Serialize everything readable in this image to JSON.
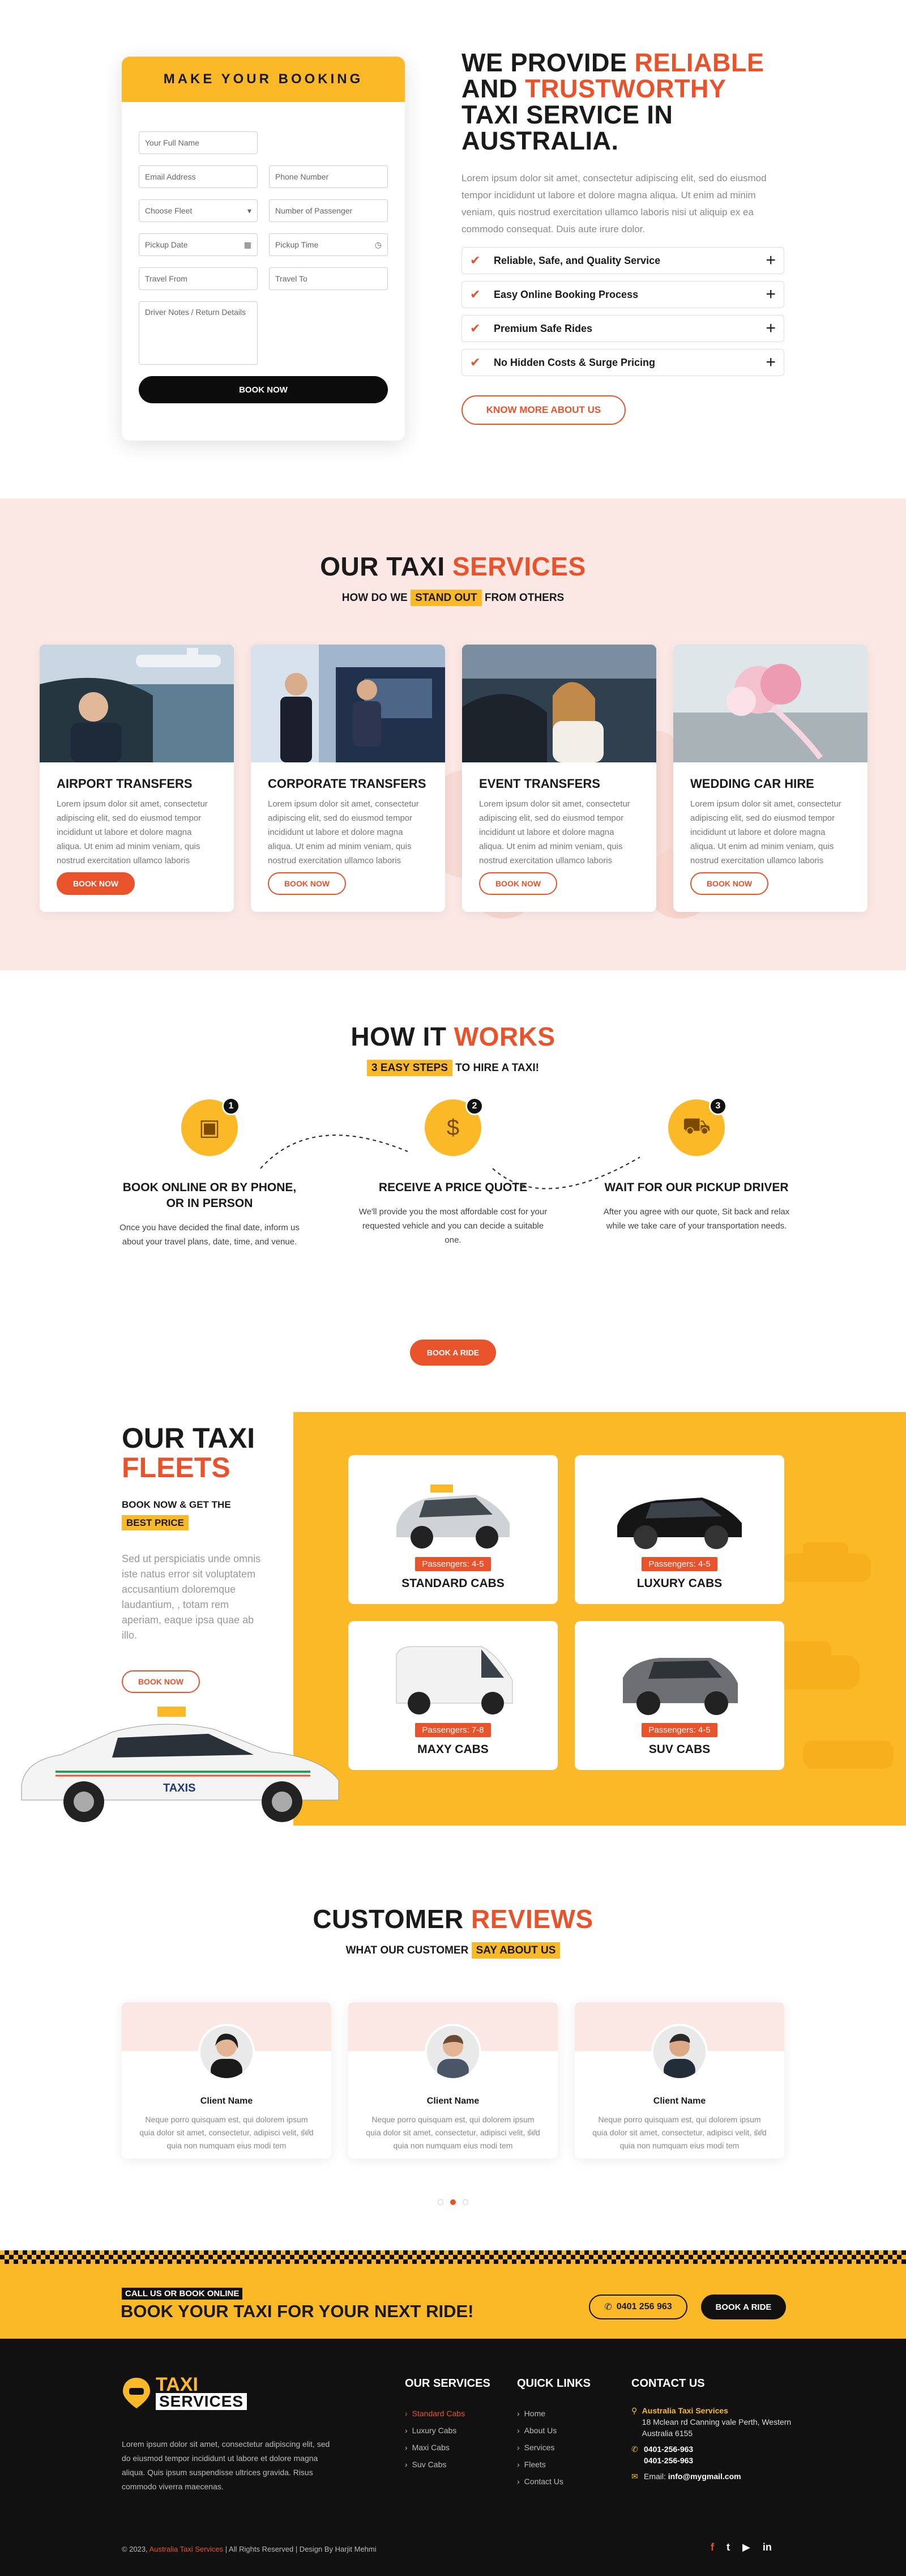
{
  "booking": {
    "title": "MAKE YOUR BOOKING",
    "full_name": "Your Full Name",
    "email": "Email Address",
    "phone": "Phone Number",
    "fleet": "Choose Fleet",
    "passengers": "Number of Passenger",
    "pickup_date": "Pickup Date",
    "pickup_time": "Pickup Time",
    "travel_from": "Travel From",
    "travel_to": "Travel To",
    "notes": "Driver Notes / Return Details",
    "button": "BOOK NOW"
  },
  "hero": {
    "title_a": "WE PROVIDE ",
    "title_b": "RELIABLE",
    "title_c": "AND ",
    "title_d": "TRUSTWORTHY",
    "title_e": "TAXI SERVICE IN",
    "title_f": "AUSTRALIA.",
    "text": "Lorem ipsum dolor sit amet, consectetur adipiscing elit, sed do eiusmod tempor incididunt ut labore et dolore magna aliqua. Ut enim ad minim veniam, quis nostrud exercitation ullamco laboris nisi ut aliquip ex ea commodo consequat. Duis aute irure dolor.",
    "features": [
      "Reliable, Safe, and Quality Service",
      "Easy Online Booking Process",
      "Premium Safe Rides",
      "No Hidden Costs & Surge Pricing"
    ],
    "button": "KNOW MORE ABOUT US"
  },
  "services": {
    "title_a": "OUR TAXI ",
    "title_b": "SERVICES",
    "sub_a": "HOW DO WE ",
    "sub_b": "STAND OUT",
    "sub_c": " FROM OTHERS",
    "cards": [
      {
        "name": "AIRPORT TRANSFERS",
        "desc": "Lorem ipsum dolor sit amet, consectetur adipiscing elit, sed do eiusmod tempor incididunt ut labore et dolore magna aliqua. Ut enim ad minim veniam, quis nostrud exercitation ullamco laboris",
        "button": "BOOK NOW"
      },
      {
        "name": "CORPORATE TRANSFERS",
        "desc": "Lorem ipsum dolor sit amet, consectetur adipiscing elit, sed do eiusmod tempor incididunt ut labore et dolore magna aliqua. Ut enim ad minim veniam, quis nostrud exercitation ullamco laboris",
        "button": "BOOK NOW"
      },
      {
        "name": "EVENT TRANSFERS",
        "desc": "Lorem ipsum dolor sit amet, consectetur adipiscing elit, sed do eiusmod tempor incididunt ut labore et dolore magna aliqua. Ut enim ad minim veniam, quis nostrud exercitation ullamco laboris",
        "button": "BOOK NOW"
      },
      {
        "name": "WEDDING CAR HIRE",
        "desc": "Lorem ipsum dolor sit amet, consectetur adipiscing elit, sed do eiusmod tempor incididunt ut labore et dolore magna aliqua. Ut enim ad minim veniam, quis nostrud exercitation ullamco laboris",
        "button": "BOOK NOW"
      }
    ]
  },
  "how": {
    "title_a": "HOW IT ",
    "title_b": "WORKS",
    "sub_a": "3 EASY STEPS",
    "sub_b": " TO HIRE A TAXI!",
    "steps": [
      {
        "num": "1",
        "icon": "calendar-check-icon",
        "title": "BOOK ONLINE OR BY PHONE, OR IN PERSON",
        "desc": "Once you have decided the final date, inform us about your travel plans, date, time, and venue."
      },
      {
        "num": "2",
        "icon": "dollar-bill-icon",
        "title": "RECEIVE A PRICE QUOTE",
        "desc": "We'll provide you the most affordable cost for your requested vehicle and you can decide a suitable one."
      },
      {
        "num": "3",
        "icon": "taxi-icon",
        "title": "WAIT FOR OUR PICKUP DRIVER",
        "desc": "After you agree with our quote, Sit back and relax while we take care of your transportation needs."
      }
    ],
    "button": "BOOK A RIDE"
  },
  "fleets": {
    "title_a": "OUR TAXI",
    "title_b": "FLEETS",
    "sub_a": "BOOK NOW & GET THE",
    "sub_b": "BEST PRICE",
    "text": "Sed ut perspiciatis unde omnis iste natus error sit voluptatem accusantium doloremque laudantium, , totam rem aperiam, eaque ipsa quae ab illo.",
    "button": "BOOK NOW",
    "cars": [
      {
        "pass": "Passengers: 4-5",
        "name": "STANDARD CABS"
      },
      {
        "pass": "Passengers: 4-5",
        "name": "LUXURY CABS"
      },
      {
        "pass": "Passengers: 7-8",
        "name": "MAXY CABS"
      },
      {
        "pass": "Passengers: 4-5",
        "name": "SUV CABS"
      }
    ],
    "car_door_text": "TAXIS"
  },
  "reviews": {
    "title_a": "CUSTOMER ",
    "title_b": "REVIEWS",
    "sub_a": "WHAT OUR CUSTOMER ",
    "sub_b": "SAY ABOUT US",
    "items": [
      {
        "name": "Client Name",
        "text": "Neque porro quisquam est, qui dolorem ipsum quia dolor sit amet, consectetur, adipisci velit, sed quia non numquam eius modi tem"
      },
      {
        "name": "Client Name",
        "text": "Neque porro quisquam est, qui dolorem ipsum quia dolor sit amet, consectetur, adipisci velit, sed quia non numquam eius modi tem"
      },
      {
        "name": "Client Name",
        "text": "Neque porro quisquam est, qui dolorem ipsum quia dolor sit amet, consectetur, adipisci velit, sed quia non numquam eius modi tem"
      }
    ]
  },
  "cta": {
    "small": "CALL US OR BOOK ONLINE",
    "big": "BOOK YOUR TAXI FOR YOUR NEXT RIDE!",
    "phone": "0401 256 963",
    "button": "BOOK A RIDE"
  },
  "footer": {
    "logo_a": "TAXI",
    "logo_b": "SERVICES",
    "about": "Lorem ipsum dolor sit amet, consectetur adipiscing elit, sed do eiusmod tempor incididunt ut labore et dolore magna aliqua. Quis ipsum suspendisse ultrices gravida. Risus commodo viverra maecenas.",
    "services_head": "OUR SERVICES",
    "services": [
      "Standard Cabs",
      "Luxury Cabs",
      "Maxi Cabs",
      "Suv Cabs"
    ],
    "links_head": "QUICK LINKS",
    "links": [
      "Home",
      "About Us",
      "Services",
      "Fleets",
      "Contact Us"
    ],
    "contact_head": "CONTACT US",
    "company": "Australia Taxi Services",
    "address": "18 Mclean rd Canning vale Perth, Western Australia 6155",
    "phone1": "0401-256-963",
    "phone2": "0401-256-963",
    "email_label": "Email: ",
    "email": "info@mygmail.com",
    "copy_a": "© 2023, ",
    "copy_b": "Australia Taxi Services",
    "copy_c": " | All Rights Reserved | Design By Harjit Mehmi",
    "social": [
      "f",
      "t",
      "▶",
      "in"
    ]
  },
  "colors": {
    "yellow": "#fbb927",
    "orange": "#e8532b",
    "pink_bg": "#fbe7e3",
    "dark": "#111111"
  }
}
